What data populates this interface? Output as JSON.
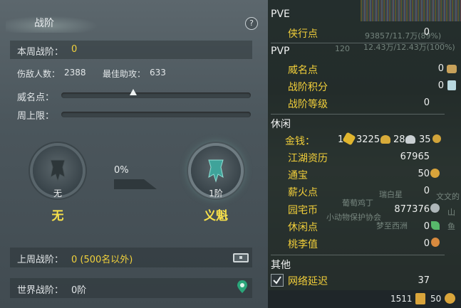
{
  "left": {
    "title": "战阶",
    "help_icon_label": "?",
    "weekly_rank_label": "本周战阶：",
    "weekly_rank_value": "0",
    "damage_label": "伤敌人数：",
    "damage_value": "2388",
    "assist_label": "最佳助攻：",
    "assist_value": "633",
    "prestige_label": "威名点：",
    "prestige_progress": 0.38,
    "weekly_cap_label": "周上限：",
    "weekly_cap_progress": 0,
    "current_rank_sub": "无",
    "current_rank_name": "无",
    "progress_text": "0%",
    "next_rank_sub": "1阶",
    "next_rank_name": "义魁",
    "last_week_label": "上周战阶：",
    "last_week_value": "0 (500名以外)",
    "world_rank_label": "世界战阶：",
    "world_rank_value": "0阶"
  },
  "right": {
    "background_text": [
      "93857/11.7万(89%)",
      "12.43万/12.43万(100%)",
      "120",
      "葡萄鸡丁",
      "瑞白星",
      "小动物保护协会",
      "梦至西洲",
      "文文的",
      "山",
      "鱼"
    ],
    "sections": {
      "pve": "PVE",
      "pvp": "PVP",
      "leisure": "休闲",
      "other": "其他"
    },
    "pve_items": [
      {
        "label": "侠行点",
        "value": "0"
      }
    ],
    "pvp_items": [
      {
        "label": "威名点",
        "value": "0",
        "icon": "medal-icon"
      },
      {
        "label": "战阶积分",
        "value": "0",
        "icon": "crystal-icon"
      },
      {
        "label": "战阶等级",
        "value": "0"
      }
    ],
    "money": {
      "label": "金钱：",
      "gold_bar": "1",
      "gold": "3225",
      "silver": "28",
      "copper": "35"
    },
    "leisure_items": [
      {
        "label": "江湖资历",
        "value": "67965"
      },
      {
        "label": "通宝",
        "value": "50",
        "icon": "coin-icon"
      },
      {
        "label": "薪火点",
        "value": "0"
      },
      {
        "label": "园宅币",
        "value": "877376",
        "icon": "g-icon"
      },
      {
        "label": "休闲点",
        "value": "0",
        "icon": "leaf-icon"
      },
      {
        "label": "桃李值",
        "value": "0",
        "icon": "peach-icon"
      }
    ],
    "other_items": [
      {
        "label": "网络延迟",
        "value": "37",
        "checked": true
      }
    ],
    "bottom": {
      "left_value": "1511",
      "right_value": "50"
    }
  }
}
